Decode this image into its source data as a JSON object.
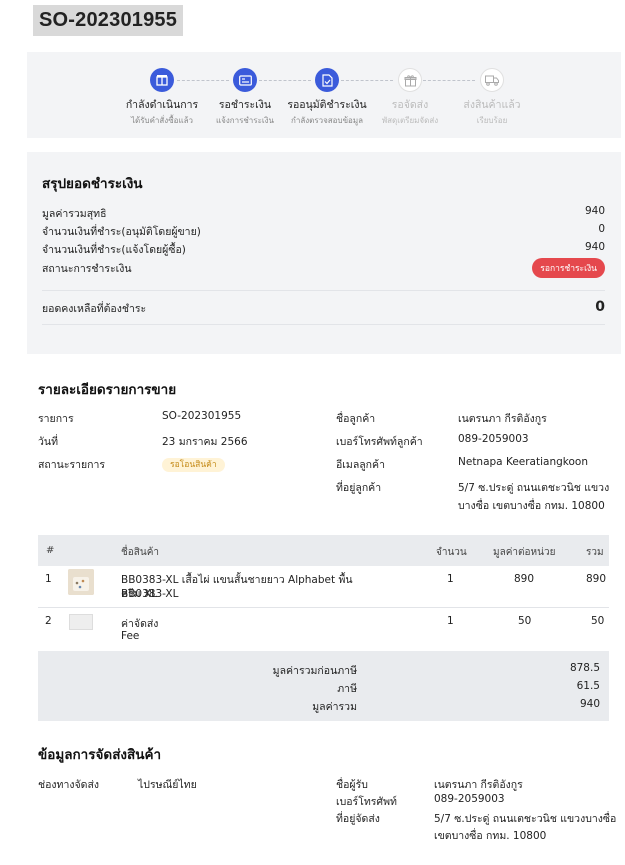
{
  "order": {
    "number": "SO-202301955"
  },
  "steps": [
    {
      "label": "กำลังดำเนินการ",
      "sub": "ได้รับคำสั่งซื้อแล้ว",
      "state": "active",
      "icon": "box-icon"
    },
    {
      "label": "รอชำระเงิน",
      "sub": "แจ้งการชำระเงิน",
      "state": "active",
      "icon": "payment-card-icon"
    },
    {
      "label": "รออนุมัติชำระเงิน",
      "sub": "กำลังตรวจสอบข้อมูล",
      "state": "active",
      "icon": "document-check-icon"
    },
    {
      "label": "รอจัดส่ง",
      "sub": "พัสดุเตรียมจัดส่ง",
      "state": "inactive",
      "icon": "gift-box-icon"
    },
    {
      "label": "ส่งสินค้าแล้ว",
      "sub": "เรียบร้อย",
      "state": "inactive",
      "icon": "truck-icon"
    }
  ],
  "summary": {
    "title": "สรุปยอดชำระเงิน",
    "net_label": "มูลค่ารวมสุทธิ",
    "net_value": "940",
    "paid_approved_label": "จำนวนเงินที่ชำระ(อนุมัติโดยผู้ขาย)",
    "paid_approved_value": "0",
    "paid_reported_label": "จำนวนเงินที่ชำระ(แจ้งโดยผู้ซื้อ)",
    "paid_reported_value": "940",
    "status_label": "สถานะการชำระเงิน",
    "status_badge": "รอการชำระเงิน",
    "status_color": "#e5484d",
    "balance_label": "ยอดคงเหลือที่ต้องชำระ",
    "balance_value": "0"
  },
  "details": {
    "title": "รายละเอียดรายการขาย",
    "item_label": "รายการ",
    "item_value": "SO-202301955",
    "date_label": "วันที่",
    "date_value": "23 มกราคม 2566",
    "status_label": "สถานะรายการ",
    "status_badge": "รอโอนสินค้า",
    "customer_label": "ชื่อลูกค้า",
    "customer_value": "เนตรนภา กีรติอังกูร",
    "phone_label": "เบอร์โทรศัพท์ลูกค้า",
    "phone_value": "089-2059003",
    "email_label": "อีเมลลูกค้า",
    "email_value": "Netnapa Keeratiangkoon",
    "address_label": "ที่อยู่ลูกค้า",
    "address_line1": "5/7 ซ.ประดู่ ถนนเตชะวนิช แขวง",
    "address_line2": "บางซื่อ เขตบางซื่อ กทม. 10800"
  },
  "table": {
    "headers": {
      "num": "#",
      "name": "ชื่อสินค้า",
      "qty": "จำนวน",
      "unit": "มูลค่าต่อหน่วย",
      "total": "รวม"
    },
    "rows": [
      {
        "num": "1",
        "name": "BB0383-XL เสื้อไผ่ แขนสั้นชายยาว Alphabet พื้นครีม XL",
        "sku": "BB0383-XL",
        "qty": "1",
        "unit": "890",
        "total": "890"
      },
      {
        "num": "2",
        "name": "ค่าจัดส่ง",
        "sku": "Fee",
        "qty": "1",
        "unit": "50",
        "total": "50"
      }
    ],
    "pretax_label": "มูลค่ารวมก่อนภาษี",
    "pretax_value": "878.5",
    "tax_label": "ภาษี",
    "tax_value": "61.5",
    "grand_label": "มูลค่ารวม",
    "grand_value": "940"
  },
  "shipping": {
    "title": "ข้อมูลการจัดส่งสินค้า",
    "channel_label": "ช่องทางจัดส่ง",
    "channel_value": "ไปรษณีย์ไทย",
    "recipient_label": "ชื่อผู้รับ",
    "recipient_value": "เนตรนภา กีรติอังกูร",
    "phone_label": "เบอร์โทรศัพท์",
    "phone_value": "089-2059003",
    "address_label": "ที่อยู่จัดส่ง",
    "address_line1": "5/7 ซ.ประดู่ ถนนเตชะวนิช แขวงบางซื่อ",
    "address_line2": "เขตบางซื่อ กทม. 10800"
  }
}
